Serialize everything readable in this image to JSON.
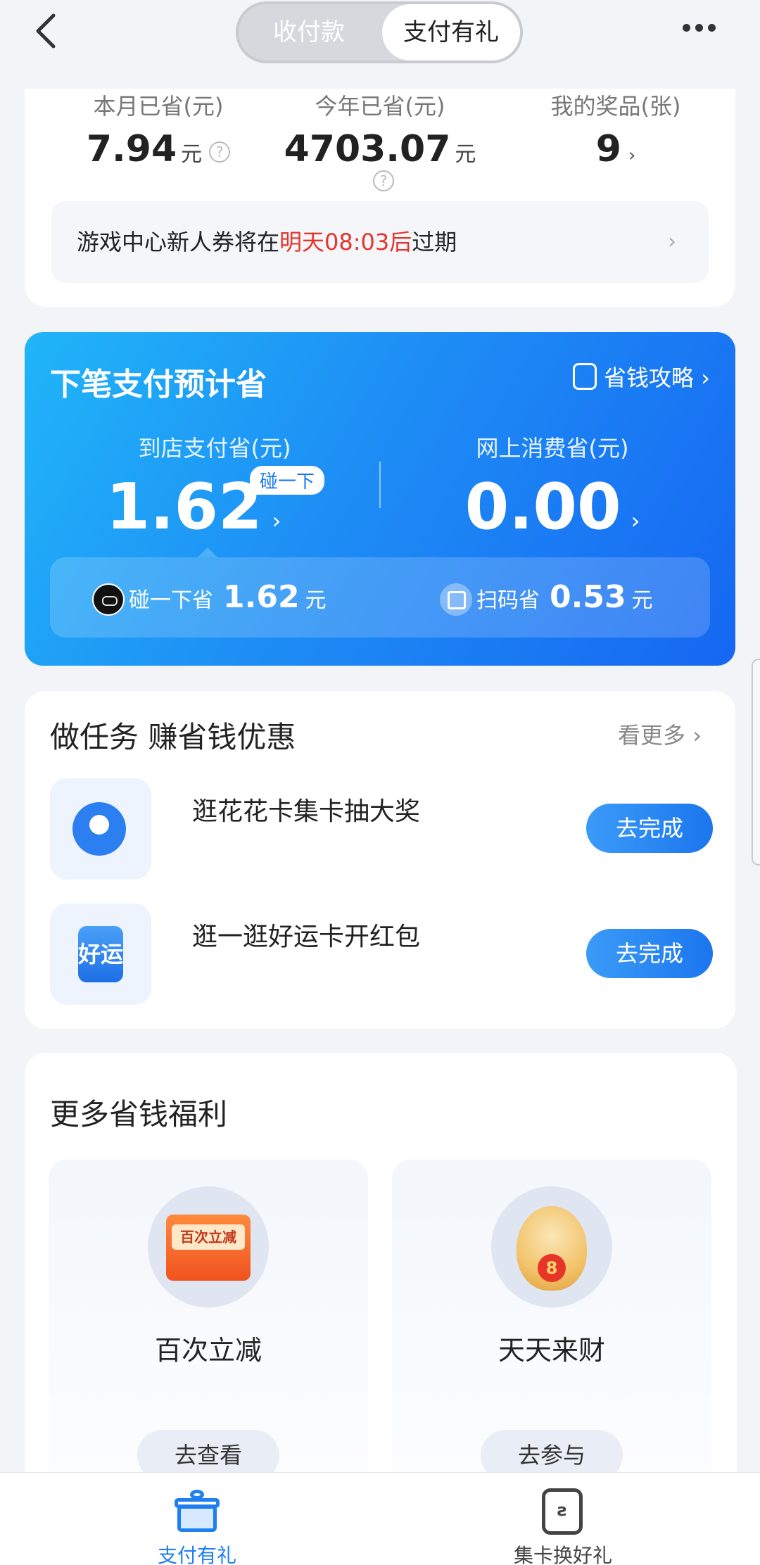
{
  "header": {
    "segment": [
      "收付款",
      "支付有礼"
    ],
    "active_segment": "支付有礼"
  },
  "summary": {
    "month": {
      "label": "本月已省(元)",
      "value": "7.94",
      "unit": "元"
    },
    "year": {
      "label": "今年已省(元)",
      "value": "4703.07",
      "unit": "元"
    },
    "prizes": {
      "label": "我的奖品(张)",
      "value": "9"
    },
    "notice": {
      "prefix": "游戏中心新人券将在",
      "highlight": "明天08:03后",
      "suffix": "过期",
      "arrow": "›"
    }
  },
  "estimate": {
    "title": "下笔支付预计省",
    "guide": "省钱攻略 ›",
    "store": {
      "label": "到店支付省(元)",
      "value": "1.62",
      "tag": "碰一下",
      "arrow": "›"
    },
    "online": {
      "label": "网上消费省(元)",
      "value": "0.00",
      "arrow": "›"
    },
    "peng": {
      "label": "碰一下省",
      "value": "1.62",
      "unit": "元"
    },
    "scan": {
      "label": "扫码省",
      "value": "0.53",
      "unit": "元"
    }
  },
  "tasks": {
    "title": "做任务 赚省钱优惠",
    "more": "看更多 ›",
    "items": [
      {
        "name": "逛花花卡集卡抽大奖",
        "button": "去完成"
      },
      {
        "name": "逛一逛好运卡开红包",
        "button": "去完成",
        "icon_text": "好运"
      }
    ]
  },
  "welfare": {
    "title": "更多省钱福利",
    "items": [
      {
        "name": "百次立减",
        "button": "去查看",
        "badge": "百次立减"
      },
      {
        "name": "天天来财",
        "button": "去参与",
        "badge": "8"
      }
    ]
  },
  "bottom_nav": {
    "items": [
      {
        "label": "支付有礼",
        "icon": "gift-icon",
        "active": true
      },
      {
        "label": "集卡换好礼",
        "icon": "card-icon",
        "active": false
      }
    ],
    "active_color": "#1f7ff0"
  }
}
